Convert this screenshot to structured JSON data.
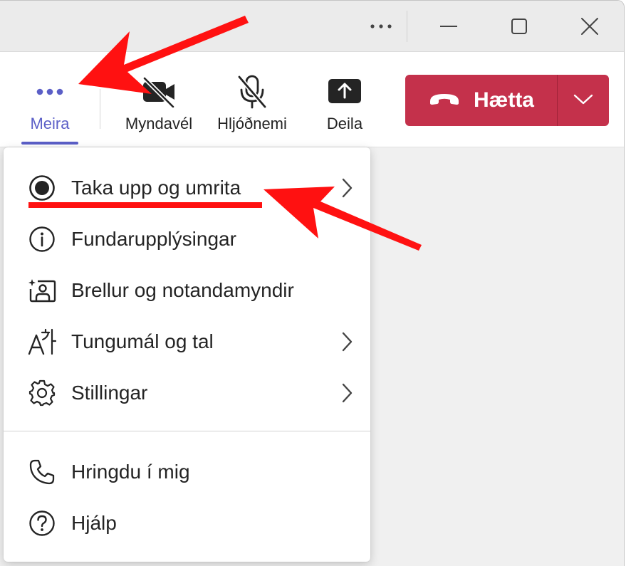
{
  "titlebar": {
    "icons": [
      "more-horizontal-icon",
      "minimize-icon",
      "maximize-icon",
      "close-icon"
    ]
  },
  "toolbar": {
    "more": {
      "label": "Meira",
      "icon": "more-horizontal-icon"
    },
    "camera": {
      "label": "Myndavél",
      "icon": "video-off-icon"
    },
    "mic": {
      "label": "Hljóðnemi",
      "icon": "mic-off-icon"
    },
    "share": {
      "label": "Deila",
      "icon": "share-screen-icon"
    },
    "leave": {
      "label": "Hætta",
      "icon": "phone-hangup-icon"
    }
  },
  "menu": {
    "items": [
      {
        "label": "Taka upp og umrita",
        "icon": "record-icon",
        "submenu": true
      },
      {
        "label": "Fundarupplýsingar",
        "icon": "info-icon",
        "submenu": false
      },
      {
        "label": "Brellur og notandamyndir",
        "icon": "effects-avatar-icon",
        "submenu": false
      },
      {
        "label": "Tungumál og tal",
        "icon": "language-icon",
        "submenu": true
      },
      {
        "label": "Stillingar",
        "icon": "gear-icon",
        "submenu": true
      },
      {
        "label": "Hringdu í mig",
        "icon": "phone-icon",
        "submenu": false
      },
      {
        "label": "Hjálp",
        "icon": "help-icon",
        "submenu": false
      }
    ]
  },
  "colors": {
    "accent": "#5b5fc7",
    "leave": "#c4314b",
    "annotation": "#ff0000"
  }
}
